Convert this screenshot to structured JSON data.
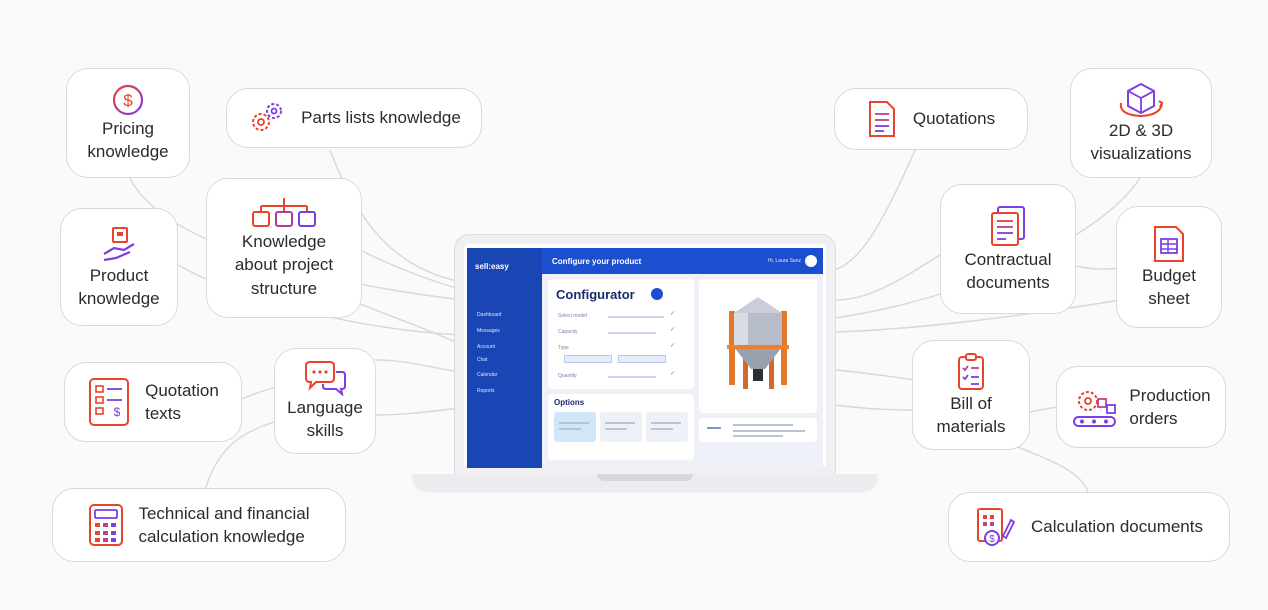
{
  "nodes": {
    "pricing": {
      "label": "Pricing\nknowledge",
      "icon": "dollar-coin-icon"
    },
    "parts_lists": {
      "label": "Parts lists knowledge",
      "icon": "gears-icon"
    },
    "product": {
      "label": "Product\nknowledge",
      "icon": "hand-holding-box-icon"
    },
    "project_structure": {
      "label": "Knowledge\nabout project\nstructure",
      "icon": "hierarchy-icon"
    },
    "quotation_texts": {
      "label": "Quotation\ntexts",
      "icon": "price-list-icon"
    },
    "language_skills": {
      "label": "Language\nskills",
      "icon": "speech-bubbles-icon"
    },
    "technical_financial": {
      "label": "Technical and financial\ncalculation knowledge",
      "icon": "calculator-icon"
    },
    "quotations": {
      "label": "Quotations",
      "icon": "document-icon"
    },
    "visualizations": {
      "label": "2D & 3D\nvisualizations",
      "icon": "cube-icon"
    },
    "contractual": {
      "label": "Contractual\ndocuments",
      "icon": "stacked-documents-icon"
    },
    "budget": {
      "label": "Budget\nsheet",
      "icon": "spreadsheet-icon"
    },
    "bill_of_materials": {
      "label": "Bill of\nmaterials",
      "icon": "clipboard-checklist-icon"
    },
    "production_orders": {
      "label": "Production\norders",
      "icon": "conveyor-gear-icon"
    },
    "calculation_documents": {
      "label": "Calculation documents",
      "icon": "calculation-sheet-icon"
    }
  },
  "app": {
    "brand": "sell:easy",
    "top_title": "Configure your product",
    "user": "Hi, Laura Sanz",
    "nav": [
      "Dashboard",
      "Messages",
      "Account",
      "Chat",
      "Calendar",
      "Reports"
    ],
    "configurator_title": "Configurator",
    "rows": [
      "Select model",
      "Capacity",
      "Type",
      "Quantity"
    ],
    "options_title": "Options"
  },
  "colors": {
    "accent_start": "#e8432d",
    "accent_end": "#7b3fe4",
    "app_blue": "#1c4fd0"
  }
}
